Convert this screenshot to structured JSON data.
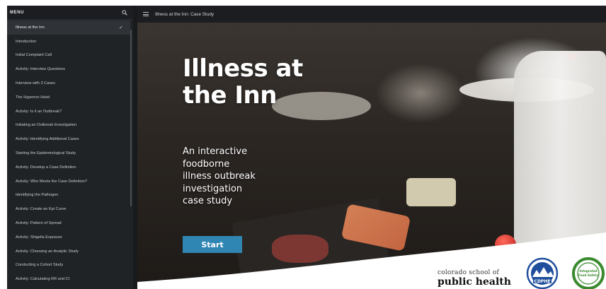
{
  "sidebar": {
    "title": "MENU",
    "items": [
      {
        "label": "Illness at the Inn",
        "active": true
      },
      {
        "label": "Introduction"
      },
      {
        "label": "Initial Complaint Call"
      },
      {
        "label": "Activity: Interview Questions"
      },
      {
        "label": "Interview with 3 Cases"
      },
      {
        "label": "The Hyperion Hotel"
      },
      {
        "label": "Activity: Is it an Outbreak?"
      },
      {
        "label": "Initiating an Outbreak Investigation"
      },
      {
        "label": "Activity: Identifying Additional Cases"
      },
      {
        "label": "Starting the Epidemiological Study"
      },
      {
        "label": "Activity: Develop a Case Definition"
      },
      {
        "label": "Activity: Who Meets the Case Definition?"
      },
      {
        "label": "Identifying the Pathogen"
      },
      {
        "label": "Activity: Create an Epi Curve"
      },
      {
        "label": "Activity: Pattern of Spread"
      },
      {
        "label": "Activity: Shigella Exposure"
      },
      {
        "label": "Activity: Choosing an Analytic Study"
      },
      {
        "label": "Conducting a Cohort Study"
      },
      {
        "label": "Activity: Calculating RR and CI"
      }
    ]
  },
  "topbar": {
    "title": "Illness at the Inn: Case Study"
  },
  "hero": {
    "title_line1": "Illness at",
    "title_line2": "the Inn",
    "subtitle_lines": [
      "An interactive",
      "foodborne",
      "illness outbreak",
      "investigation",
      "case study"
    ],
    "start_label": "Start"
  },
  "logos": {
    "csph_line1": "colorado school of",
    "csph_line2": "public health",
    "cdphe_text": "CDPHE",
    "ifs_text": "Integrated Food Safety"
  },
  "colors": {
    "accent": "#2f86b3",
    "sidebar_bg": "#202326",
    "cdphe_blue": "#1f4e9c",
    "ifs_green": "#3a8a2f"
  }
}
